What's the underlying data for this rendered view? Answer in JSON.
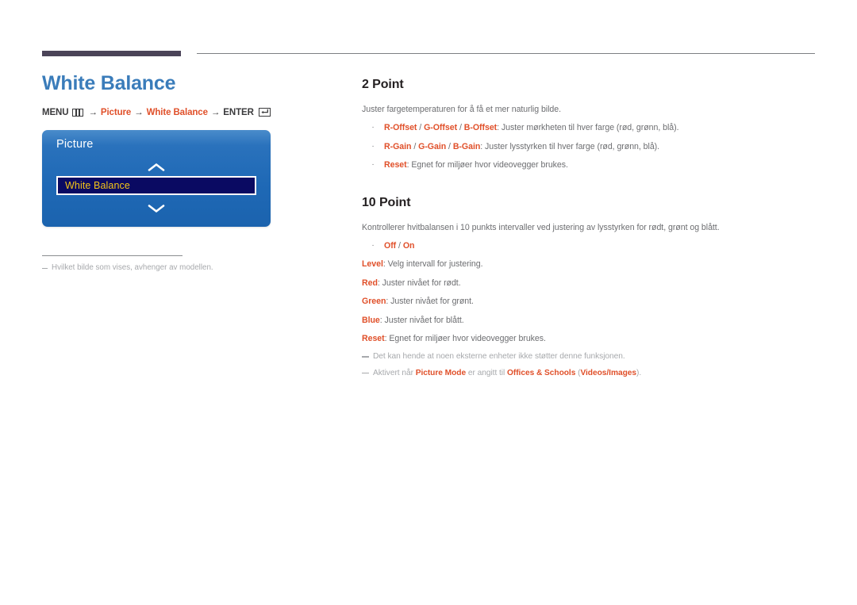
{
  "page": {
    "title": "White Balance",
    "menu_path": {
      "menu_label": "MENU",
      "menu_icon": "menu-grid-icon",
      "arrow": "→",
      "step1": "Picture",
      "step2": "White Balance",
      "enter_label": "ENTER",
      "enter_icon": "enter-return-icon"
    }
  },
  "osd": {
    "title": "Picture",
    "up_icon": "chevron-up-icon",
    "down_icon": "chevron-down-icon",
    "selected_item": "White Balance"
  },
  "left_note": {
    "dash": "–",
    "text": "Hvilket bilde som vises, avhenger av modellen."
  },
  "sections": [
    {
      "heading": "2 Point",
      "intro": "Juster fargetemperaturen for å få et mer naturlig bilde.",
      "bullets": [
        {
          "bullet": "·",
          "key": "R-Offset / G-Offset / B-Offset",
          "key_parts": [
            "R-Offset",
            "G-Offset",
            "B-Offset"
          ],
          "value": ": Juster mørkheten til hver farge (rød, grønn, blå)."
        },
        {
          "bullet": "·",
          "key": "R-Gain / G-Gain / B-Gain",
          "key_parts": [
            "R-Gain",
            "G-Gain",
            "B-Gain"
          ],
          "value": ": Juster lysstyrken til hver farge (rød, grønn, blå)."
        },
        {
          "bullet": "·",
          "key": "Reset",
          "key_parts": [
            "Reset"
          ],
          "value": ": Egnet for miljøer hvor videovegger brukes."
        }
      ]
    },
    {
      "heading": "10 Point",
      "intro": "Kontrollerer hvitbalansen i 10 punkts intervaller ved justering av lysstyrken for rødt, grønt og blått.",
      "toggle_bullet": {
        "bullet": "·",
        "off": "Off",
        "sep": " / ",
        "on": "On"
      },
      "entries": [
        {
          "key": "Level",
          "value": ": Velg intervall for justering."
        },
        {
          "key": "Red",
          "value": ": Juster nivået for rødt."
        },
        {
          "key": "Green",
          "value": ": Juster nivået for grønt."
        },
        {
          "key": "Blue",
          "value": ": Juster nivået for blått."
        },
        {
          "key": "Reset",
          "value": ": Egnet for miljøer hvor videovegger brukes."
        }
      ],
      "footnotes": [
        {
          "text": "Det kan hende at noen eksterne enheter ikke støtter denne funksjonen."
        },
        {
          "pre": "Aktivert når ",
          "hot1": "Picture Mode",
          "mid": " er angitt til ",
          "hot2": "Offices & Schools",
          "paren_open": " (",
          "hot3": "Videos/Images",
          "paren_close": ")."
        }
      ]
    }
  ],
  "colors": {
    "title_blue": "#3a7cba",
    "accent_orange": "#e0502a",
    "body_gray": "#6d6e71",
    "note_gray": "#a7a9ac",
    "rule_purple": "#4b4458",
    "osd_blue": "#1f69b6",
    "osd_item_navy": "#0a0a62",
    "osd_item_text": "#f5c518"
  }
}
